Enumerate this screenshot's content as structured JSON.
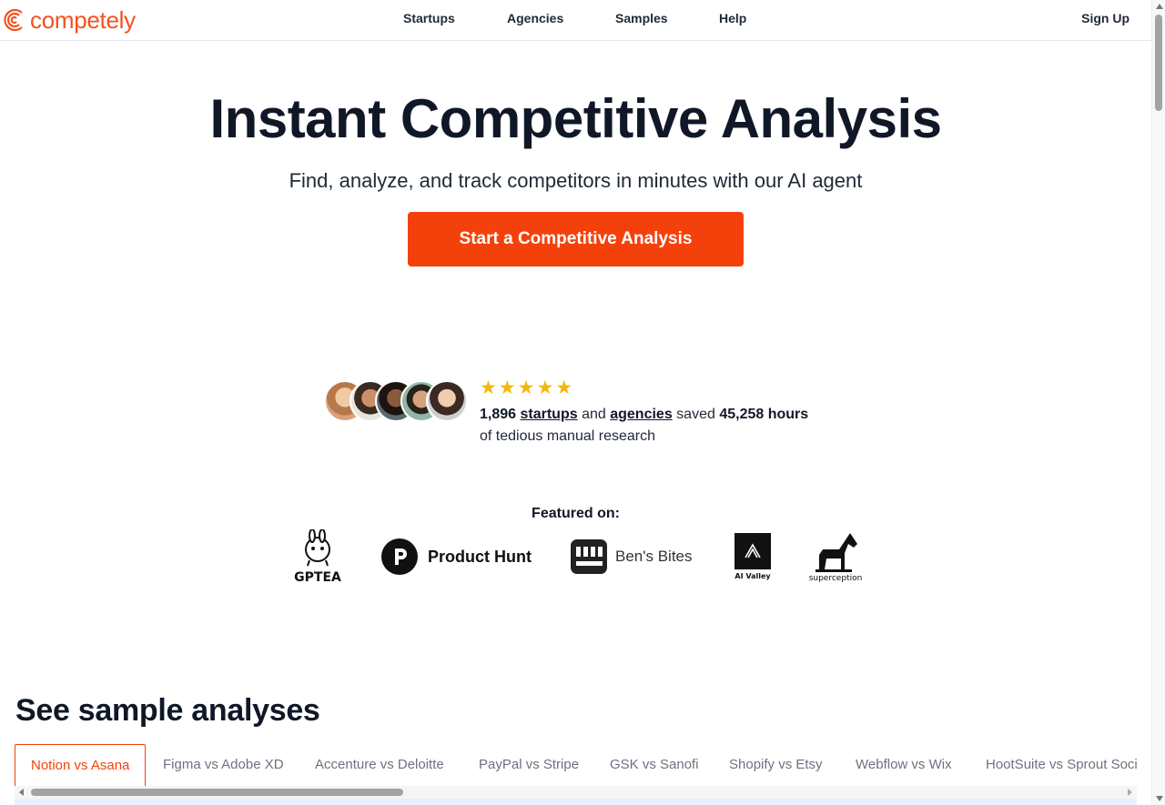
{
  "brand": {
    "name": "competely",
    "color": "#f4511e"
  },
  "nav": {
    "items": [
      "Startups",
      "Agencies",
      "Samples",
      "Help"
    ],
    "signup": "Sign Up"
  },
  "hero": {
    "title": "Instant Competitive Analysis",
    "subtitle": "Find, analyze, and track competitors in minutes with our AI agent",
    "cta": "Start a Competitive Analysis",
    "cta_color": "#f4410b"
  },
  "social_proof": {
    "rating_stars": 5,
    "count": "1,896",
    "startups": "startups",
    "and": "and",
    "agencies": "agencies",
    "saved": "saved",
    "hours": "45,258 hours",
    "line2": "of tedious manual research"
  },
  "featured": {
    "title": "Featured on:",
    "logos": {
      "gptea": "GPTEA",
      "product_hunt": "Product Hunt",
      "bens_bites": "Ben's Bites",
      "ai_valley": "AI Valley",
      "superception": "superception"
    }
  },
  "samples": {
    "title": "See sample analyses",
    "tabs": [
      "Notion vs Asana",
      "Figma vs Adobe XD",
      "Accenture vs Deloitte",
      "PayPal vs Stripe",
      "GSK vs Sanofi",
      "Shopify vs Etsy",
      "Webflow vs Wix",
      "HootSuite vs Sprout Social"
    ],
    "active_tab": 0
  }
}
